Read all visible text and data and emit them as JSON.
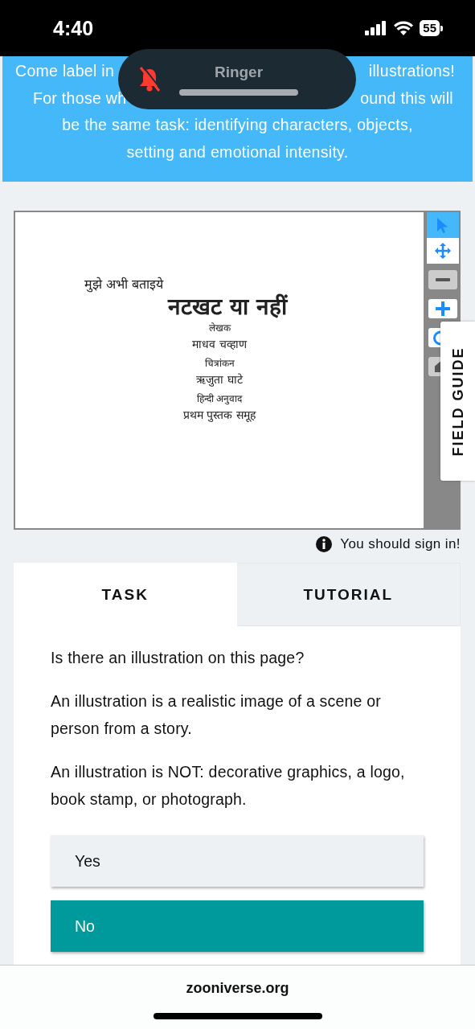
{
  "status_bar": {
    "time": "4:40",
    "battery": "55"
  },
  "ringer_overlay": {
    "title": "Ringer"
  },
  "banner": {
    "lines": [
      {
        "left": "Come label in",
        "right": "illustrations!"
      },
      {
        "left": "For those wh",
        "right": "ound this will"
      },
      {
        "text": "be the same task: identifying characters, objects,"
      },
      {
        "text": "setting and emotional intensity."
      }
    ]
  },
  "viewer": {
    "page_lines": [
      {
        "kind": "series",
        "text": "मुझे अभी बताइये"
      },
      {
        "kind": "title",
        "text": "नटखट या नहीं"
      },
      {
        "kind": "role",
        "text": "लेखक"
      },
      {
        "kind": "name",
        "text": "माधव चव्हाण"
      },
      {
        "kind": "role",
        "text": "चित्रांकन"
      },
      {
        "kind": "name",
        "text": "ऋजुता घाटे"
      },
      {
        "kind": "role",
        "text": "हिन्दी अनुवाद"
      },
      {
        "kind": "name",
        "text": "प्रथम पुस्तक समूह"
      }
    ],
    "tools": [
      {
        "kind": "pointer",
        "selected": true
      },
      {
        "kind": "move",
        "selected": false
      },
      {
        "kind": "zoom-out",
        "selected": false
      },
      {
        "kind": "zoom-in",
        "selected": false
      },
      {
        "kind": "rotate",
        "selected": false
      },
      {
        "kind": "reset",
        "selected": false
      }
    ],
    "field_guide": "FIELD GUIDE"
  },
  "sign_in_notice": "You should sign in!",
  "tabs": [
    {
      "label": "TASK",
      "selected": true
    },
    {
      "label": "TUTORIAL",
      "selected": false
    }
  ],
  "task": {
    "paragraphs": [
      "Is there an illustration on this page?",
      "An illustration is a realistic image of a scene or person from a story.",
      "An illustration is NOT: decorative graphics, a logo, book stamp, or photograph."
    ],
    "answers": [
      {
        "label": "Yes",
        "selected": false
      },
      {
        "label": "No",
        "selected": true
      }
    ]
  },
  "browser_bar": {
    "url": "zooniverse.org"
  }
}
